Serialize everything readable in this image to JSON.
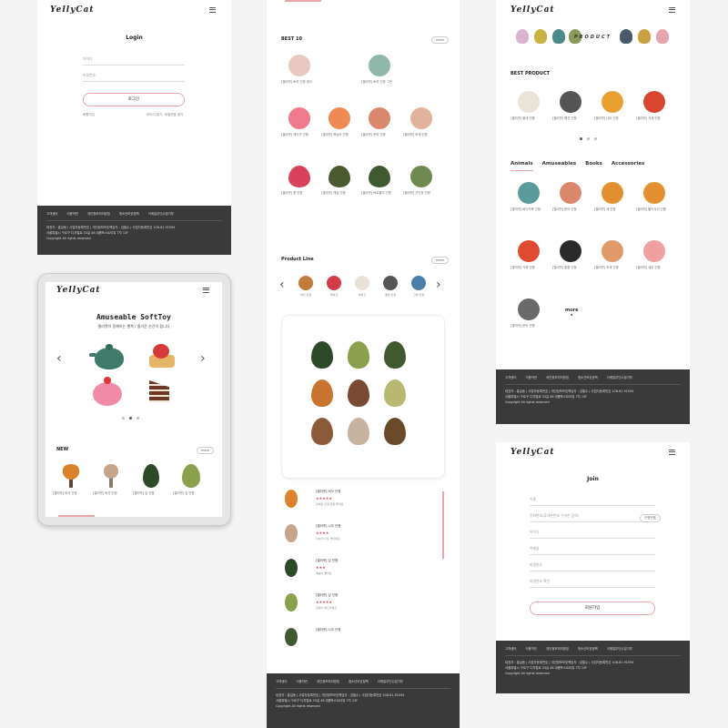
{
  "brand": {
    "logo": "YellyCat"
  },
  "login": {
    "title": "Login",
    "id_placeholder": "아이디",
    "pw_placeholder": "비밀번호",
    "login_button": "로그인",
    "join_link": "회원가입",
    "find_id_link": "아이디 찾기",
    "find_pw_link": "비밀번호 찾기"
  },
  "footer": {
    "links": [
      "고객센터",
      "이용약관",
      "개인정보처리방침",
      "청소년보호정책",
      "이메일무단수집거부"
    ],
    "info1": "대표자 : 홍길동 | 사업자등록번호 | 개인정보보호책임자 : 김철수 | 사업자등록번호 108-81-91594",
    "info2": "서울특별시 구로구 디지털로 33길 48 대륭포스트타워 7차 13F",
    "copyright": "Copyright All rights reserved"
  },
  "tablet": {
    "hero_title": "Amuseable SoftToy",
    "hero_sub": "젤리캣이 함께하는 행복 / 즐거운 순간이 됩니다",
    "new_title": "NEW",
    "more": "more",
    "new_items": [
      "[젤리캣] 버섯 인형",
      "[젤리캣] 버섯 인형",
      "[젤리캣] 잎 인형",
      "[젤리캣] 잎 인형"
    ]
  },
  "best": {
    "title": "BEST 10",
    "more": "more",
    "items": [
      "[젤리캣] 토끼 인형 핑크",
      "[젤리캣] 토끼 인형 그린",
      "[젤리캣] 케이크 인형",
      "[젤리캣] 복숭아 인형",
      "[젤리캣] 문어 인형",
      "[젤리캣] 조개 인형",
      "[젤리캣] 꽃 인형",
      "[젤리캣] 케일 인형",
      "[젤리캣] 브로콜리 인형",
      "[젤리캣] 선인장 인형"
    ]
  },
  "product_line": {
    "title": "Product Line",
    "more": "more",
    "items": [
      "버섯 인형",
      "케이크",
      "하우스",
      "펭귄 인형",
      "고래 인형"
    ]
  },
  "reviews": [
    {
      "name": "[젤리캣] 버섯 인형",
      "stars": "★★★★★",
      "text": "귀여운 인형 정말 좋아요"
    },
    {
      "name": "[젤리캣] 나무 인형",
      "stars": "★★★★",
      "text": "아이가 너무 좋아해요"
    },
    {
      "name": "[젤리캣] 잎 인형",
      "stars": "★★★",
      "text": "배송이 빨라요"
    },
    {
      "name": "[젤리캣] 잎 인형",
      "stars": "★★★★★",
      "text": "감촉이 부드러워요"
    },
    {
      "name": "[젤리캣] 나무 인형",
      "stars": "",
      "text": ""
    }
  ],
  "right": {
    "product_label": "PRODUCT",
    "best_product": "BEST PRODUCT",
    "best_items": [
      "[젤리캣] 물개 인형",
      "[젤리캣] 펭귄 인형",
      "[젤리캣] 나비 인형",
      "[젤리캣] 가재 인형"
    ],
    "tabs": [
      "Animals",
      "Amuseables",
      "Books",
      "Accessories"
    ],
    "grid_items": [
      "[젤리캣] 바다거북 인형",
      "[젤리캣] 문어 인형",
      "[젤리캣] 게 인형",
      "[젤리캣] 불가사리 인형",
      "[젤리캣] 가재 인형",
      "[젤리캣] 홍합 인형",
      "[젤리캣] 조개 인형",
      "[젤리캣] 새우 인형",
      "[젤리캣] 문어 인형"
    ],
    "more": "more"
  },
  "join": {
    "title": "Join",
    "fields": [
      "이름",
      "전화번호(휴대폰번호 숫자만 입력)",
      "아이디",
      "이메일",
      "비밀번호",
      "비밀번호 확인"
    ],
    "verify": "인증번호",
    "button": "회원가입"
  },
  "colors": {
    "accent": "#e8a4a9",
    "footer": "#3b3a3b"
  }
}
